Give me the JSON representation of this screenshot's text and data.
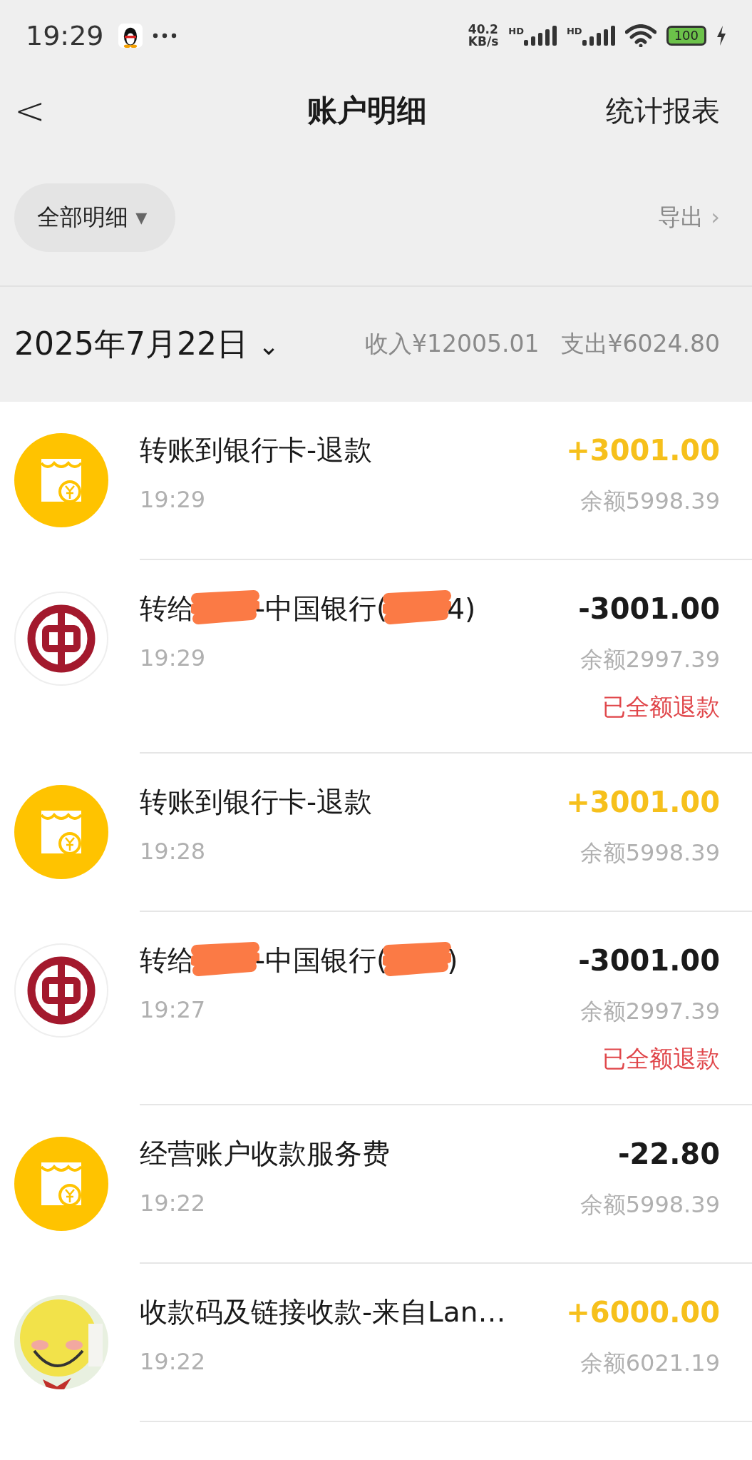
{
  "status_bar": {
    "time": "19:29",
    "speed_value": "40.2",
    "speed_unit": "KB/s",
    "sim_1_label": "HD",
    "sim_2_label": "HD",
    "battery": "100"
  },
  "header": {
    "back": "<",
    "title": "账户明细",
    "action": "统计报表"
  },
  "filter": {
    "label": "全部明细",
    "caret": "▾",
    "export": "导出",
    "export_arrow": "›"
  },
  "date_bar": {
    "date": "2025年7月22日",
    "caret": "⌄",
    "income": "收入¥12005.01",
    "expense": "支出¥6024.80"
  },
  "transactions": [
    {
      "kind": "shop",
      "title_parts": [
        {
          "kind": "text",
          "text": "转账到银行卡-退款"
        }
      ],
      "amount": "+3001.00",
      "color": "#f6c01c",
      "time": "19:29",
      "balance": "余额5998.39"
    },
    {
      "kind": "bank",
      "title_parts": [
        {
          "kind": "text",
          "text": "转给"
        },
        {
          "kind": "redaction"
        },
        {
          "kind": "text",
          "text": "-中国银行("
        },
        {
          "kind": "redaction"
        },
        {
          "kind": "text",
          "text": "4)"
        }
      ],
      "amount": "-3001.00",
      "color": "#1a1a1a",
      "time": "19:29",
      "balance": "余额2997.39",
      "note": "已全额退款"
    },
    {
      "kind": "shop",
      "title_parts": [
        {
          "kind": "text",
          "text": "转账到银行卡-退款"
        }
      ],
      "amount": "+3001.00",
      "color": "#f6c01c",
      "time": "19:28",
      "balance": "余额5998.39"
    },
    {
      "kind": "bank",
      "title_parts": [
        {
          "kind": "text",
          "text": "转给"
        },
        {
          "kind": "redaction"
        },
        {
          "kind": "text",
          "text": "-中国银行("
        },
        {
          "kind": "redaction"
        },
        {
          "kind": "text",
          "text": ")"
        }
      ],
      "amount": "-3001.00",
      "color": "#1a1a1a",
      "time": "19:27",
      "balance": "余额2997.39",
      "note": "已全额退款"
    },
    {
      "kind": "shop",
      "title_parts": [
        {
          "kind": "text",
          "text": "经营账户收款服务费"
        }
      ],
      "amount": "-22.80",
      "color": "#1a1a1a",
      "time": "19:22",
      "balance": "余额5998.39"
    },
    {
      "kind": "picture",
      "title_parts": [
        {
          "kind": "text",
          "text": "收款码及链接收款-来自Lan…"
        }
      ],
      "amount": "+6000.00",
      "color": "#f6c01c",
      "time": "19:22",
      "balance": "余额6021.19"
    }
  ]
}
